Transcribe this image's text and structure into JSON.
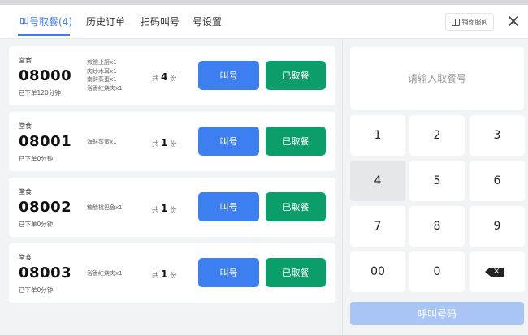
{
  "tabs": [
    {
      "label": "叫号取餐(4)"
    },
    {
      "label": "历史订单"
    },
    {
      "label": "扫码叫号"
    },
    {
      "label": "号设置"
    }
  ],
  "header": {
    "screen_btn_label": "销你服间"
  },
  "orders": [
    {
      "type": "堂食",
      "number": "08000",
      "time": "已下单120分钟",
      "items": [
        "煎鲍上厨x1",
        "肉炒木耳x1",
        "南鲜蒸蛋x1",
        "浴香红烧肉x1"
      ],
      "qty_prefix": "共",
      "qty": "4",
      "qty_unit": "份",
      "call_label": "叫号",
      "taken_label": "已取餐"
    },
    {
      "type": "堂食",
      "number": "08001",
      "time": "已下单0分钟",
      "items": [
        "海鲜蒸蛋x1"
      ],
      "qty_prefix": "共",
      "qty": "1",
      "qty_unit": "份",
      "call_label": "叫号",
      "taken_label": "已取餐"
    },
    {
      "type": "堂食",
      "number": "08002",
      "time": "已下单0分钟",
      "items": [
        "糖醋桃巴鱼x1"
      ],
      "qty_prefix": "共",
      "qty": "1",
      "qty_unit": "份",
      "call_label": "叫号",
      "taken_label": "已取餐"
    },
    {
      "type": "堂食",
      "number": "08003",
      "time": "已下单0分钟",
      "items": [
        "浴香红烧肉x1"
      ],
      "qty_prefix": "共",
      "qty": "1",
      "qty_unit": "份",
      "call_label": "叫号",
      "taken_label": "已取餐"
    }
  ],
  "keypad": {
    "input_placeholder": "请输入取餐号",
    "keys": [
      "1",
      "2",
      "3",
      "4",
      "5",
      "6",
      "7",
      "8",
      "9",
      "00",
      "0"
    ],
    "backspace_glyph": "×",
    "call_button_label": "呼叫号码"
  },
  "colors": {
    "accent": "#3d7ff0",
    "taken": "#0b9e6a",
    "call_disabled": "#a9c5f6"
  }
}
